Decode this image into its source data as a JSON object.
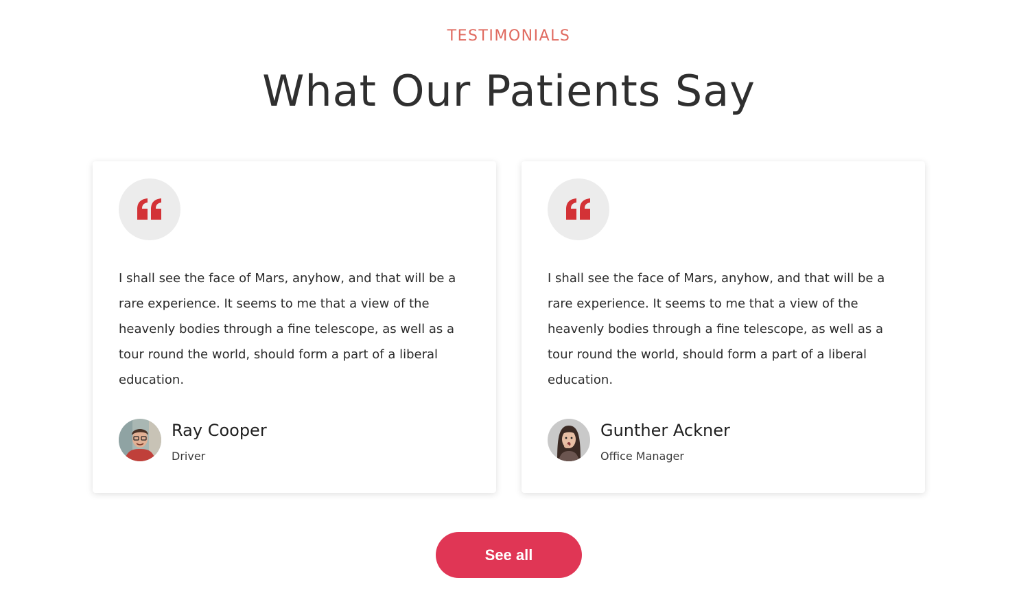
{
  "section": {
    "eyebrow": "TESTIMONIALS",
    "title": "What Our Patients Say"
  },
  "testimonials": [
    {
      "quote": "I shall see the face of Mars, anyhow, and that will be a rare experience. It seems to me that a view of the heavenly bodies through a fine telescope, as well as a tour round the world, should form a part of a liberal education.",
      "name": "Ray Cooper",
      "role": "Driver",
      "icon": "quote-icon",
      "avatar": "avatar-photo"
    },
    {
      "quote": "I shall see the face of Mars, anyhow, and that will be a rare experience. It seems to me that a view of the heavenly bodies through a fine telescope, as well as a tour round the world, should form a part of a liberal education.",
      "name": "Gunther Ackner",
      "role": "Office Manager",
      "icon": "quote-icon",
      "avatar": "avatar-photo"
    }
  ],
  "actions": {
    "see_all_label": "See all"
  },
  "colors": {
    "eyebrow": "#e06a5f",
    "quote_icon": "#d33236",
    "button": "#e03655",
    "badge": "#ececec"
  }
}
